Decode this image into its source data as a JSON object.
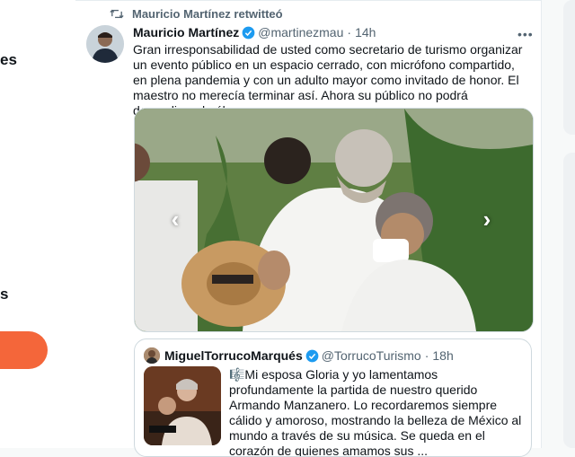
{
  "nav": {
    "frag1": "es",
    "frag2": "s"
  },
  "retweet": {
    "text": "Mauricio Martínez retwitteó"
  },
  "tweet": {
    "name": "Mauricio Martínez",
    "handle": "@martinezmau",
    "dot": "·",
    "time": "14h",
    "more": "•••",
    "text": "Gran irresponsabilidad de usted como secretario de turismo organizar un evento público en un espacio cerrado, con micrófono compartido, en plena pandemia y con un adulto mayor como invitado de honor. El maestro no merecía terminar así. Ahora su público no podrá despedirse de él."
  },
  "quote": {
    "name": "MiguelTorrucoMarqués",
    "handle": "@TorrucoTurismo",
    "dot": "·",
    "time": "18h",
    "text": "🎼Mi esposa Gloria y yo lamentamos profundamente la partida de nuestro querido Armando Manzanero. Lo recordaremos siempre cálido y amoroso, mostrando la belleza de México al mundo a través de su música. Se queda en el corazón de quienes amamos sus ..."
  },
  "colors": {
    "accent": "#1d9bf0",
    "tweet_button": "#f4663a",
    "secondary_text": "#536471"
  }
}
